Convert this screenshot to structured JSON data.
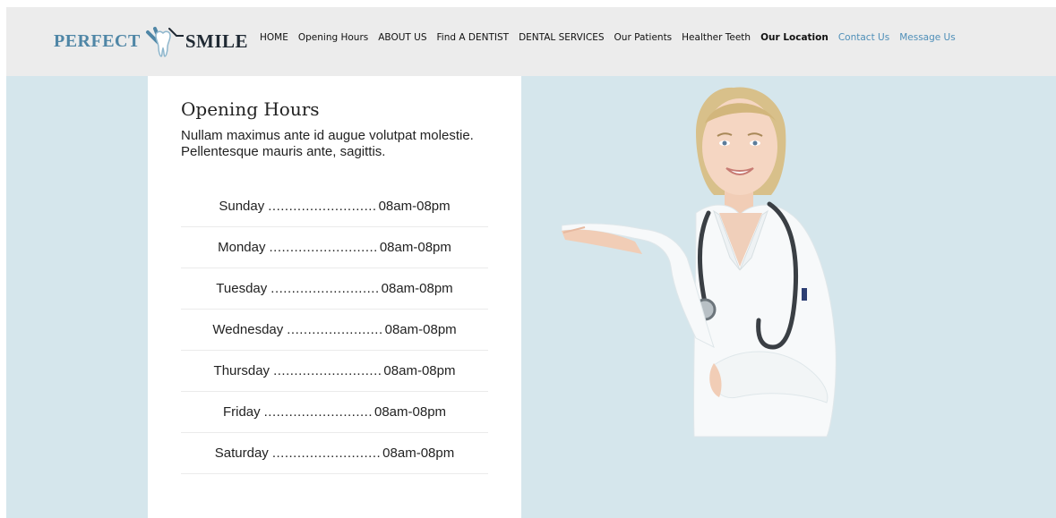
{
  "logo": {
    "word1": "PERFECT",
    "word2": "SMILE",
    "icon": "tooth-icon"
  },
  "nav": [
    {
      "label": "HOME",
      "style": "normal"
    },
    {
      "label": "Opening Hours",
      "style": "normal"
    },
    {
      "label": "ABOUT US",
      "style": "normal"
    },
    {
      "label": "Find A DENTIST",
      "style": "normal"
    },
    {
      "label": "DENTAL SERVICES",
      "style": "normal"
    },
    {
      "label": "Our Patients",
      "style": "normal"
    },
    {
      "label": "Healther Teeth",
      "style": "normal"
    },
    {
      "label": "Our Location",
      "style": "bold"
    },
    {
      "label": "Contact Us",
      "style": "blue"
    },
    {
      "label": "Message Us",
      "style": "blue"
    }
  ],
  "main": {
    "title": "Opening Hours",
    "lead": "Nullam maximus ante id augue volutpat molestie. Pellentesque mauris ante, sagittis.",
    "hours": [
      {
        "day": "Sunday",
        "dots": "..........................",
        "time": "08am-08pm"
      },
      {
        "day": "Monday",
        "dots": "..........................",
        "time": "08am-08pm"
      },
      {
        "day": "Tuesday",
        "dots": "..........................",
        "time": "08am-08pm"
      },
      {
        "day": "Wednesday",
        "dots": ".......................",
        "time": "08am-08pm"
      },
      {
        "day": "Thursday",
        "dots": "..........................",
        "time": "08am-08pm"
      },
      {
        "day": "Friday",
        "dots": "..........................",
        "time": "08am-08pm"
      },
      {
        "day": "Saturday",
        "dots": "..........................",
        "time": "08am-08pm"
      }
    ]
  },
  "colors": {
    "background": "#d5e6ec",
    "header": "#ececec",
    "accent_blue": "#4f8fb8",
    "logo_blue": "#4f86a6"
  }
}
